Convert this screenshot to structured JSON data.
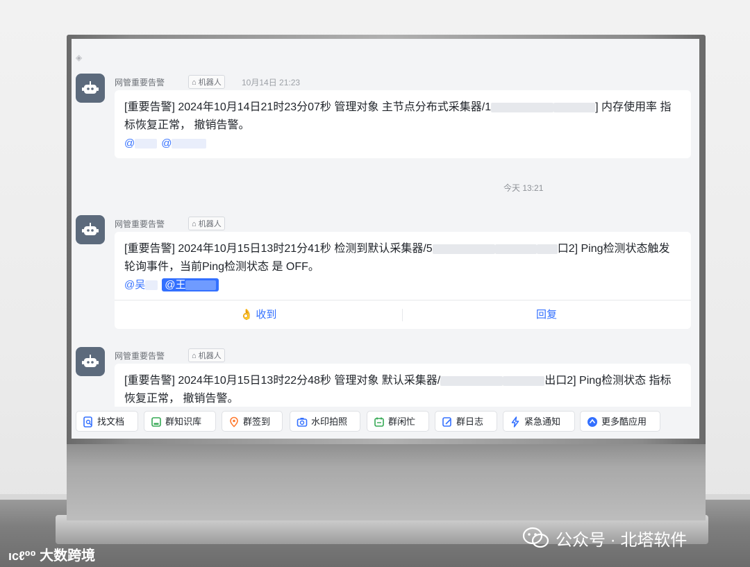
{
  "messages": [
    {
      "sender": "网管重要告警",
      "robot_tag": "机器人",
      "time": "10月14日 21:23",
      "text_before": "[重要告警] 2024年10月14日21时23分07秒 管理对象 主节点分布式采集器/1",
      "text_after": "] 内存使用率 指标恢复正常， 撤销告警。",
      "mentions": [
        "@",
        "@"
      ]
    },
    {
      "sender": "网管重要告警",
      "robot_tag": "机器人",
      "text_before": "[重要告警] 2024年10月15日13时21分41秒 检测到默认采集器/5",
      "text_after": "口2] Ping检测状态触发轮询事件，当前Ping检测状态 是 OFF。",
      "mentions": [
        "@吴",
        "@王"
      ],
      "actions": {
        "received": "收到",
        "reply": "回复"
      }
    },
    {
      "sender": "网管重要告警",
      "robot_tag": "机器人",
      "text_before": "[重要告警] 2024年10月15日13时22分48秒 管理对象 默认采集器/",
      "text_after": "出口2] Ping检测状态 指标恢复正常， 撤销告警。"
    }
  ],
  "day_separator": "今天 13:21",
  "toolbar": [
    {
      "label": "找文档",
      "icon": "search-doc-icon",
      "color": "#3370ff"
    },
    {
      "label": "群知识库",
      "icon": "knowledge-base-icon",
      "color": "#34a853"
    },
    {
      "label": "群签到",
      "icon": "checkin-icon",
      "color": "#ff7a2f"
    },
    {
      "label": "水印拍照",
      "icon": "camera-icon",
      "color": "#3370ff"
    },
    {
      "label": "群闲忙",
      "icon": "calendar-icon",
      "color": "#34a853"
    },
    {
      "label": "群日志",
      "icon": "log-icon",
      "color": "#3370ff"
    },
    {
      "label": "紧急通知",
      "icon": "lightning-icon",
      "color": "#3370ff"
    },
    {
      "label": "更多酷应用",
      "icon": "more-apps-icon",
      "color": "#3370ff"
    }
  ],
  "watermarks": {
    "left": "大数跨境",
    "right": "公众号 · 北塔软件"
  }
}
